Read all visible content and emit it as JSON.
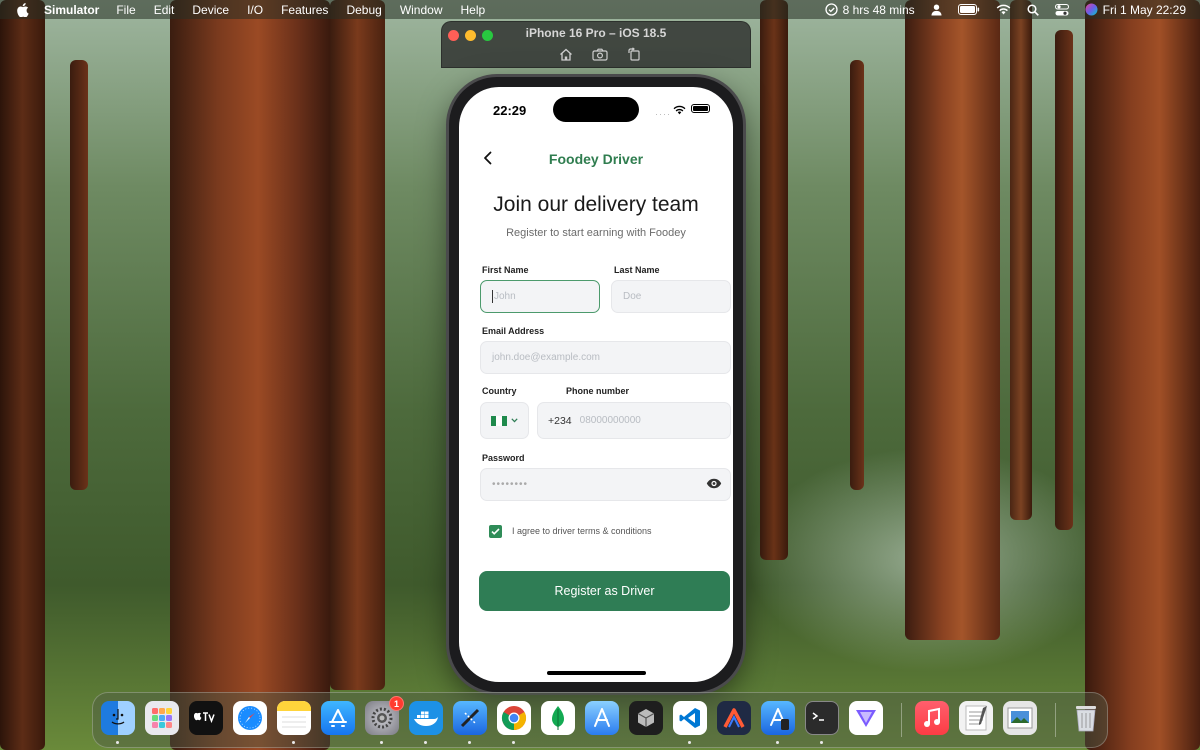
{
  "menubar": {
    "app_name": "Simulator",
    "items": [
      "File",
      "Edit",
      "Device",
      "I/O",
      "Features",
      "Debug",
      "Window",
      "Help"
    ],
    "screen_time": "8 hrs 48 mins",
    "datetime": "Fri 1 May  22:29"
  },
  "simulator": {
    "title": "iPhone 16 Pro – iOS 18.5"
  },
  "phone": {
    "status_time": "22:29",
    "app_title": "Foodey Driver",
    "heading": "Join our delivery team",
    "subheading": "Register to start earning with Foodey",
    "form": {
      "first_name_label": "First Name",
      "first_name_placeholder": "John",
      "last_name_label": "Last Name",
      "last_name_placeholder": "Doe",
      "email_label": "Email Address",
      "email_placeholder": "john.doe@example.com",
      "country_label": "Country",
      "phone_label": "Phone number",
      "dial_code": "+234",
      "phone_placeholder": "08000000000",
      "password_label": "Password",
      "password_value": "••••••••",
      "agree_text": "I agree to driver terms & conditions",
      "agree_checked": true,
      "submit_label": "Register as Driver"
    }
  },
  "dock": {
    "settings_badge": "1"
  },
  "colors": {
    "brand_green": "#2f7d55",
    "focus_border": "#4c9a6c"
  }
}
